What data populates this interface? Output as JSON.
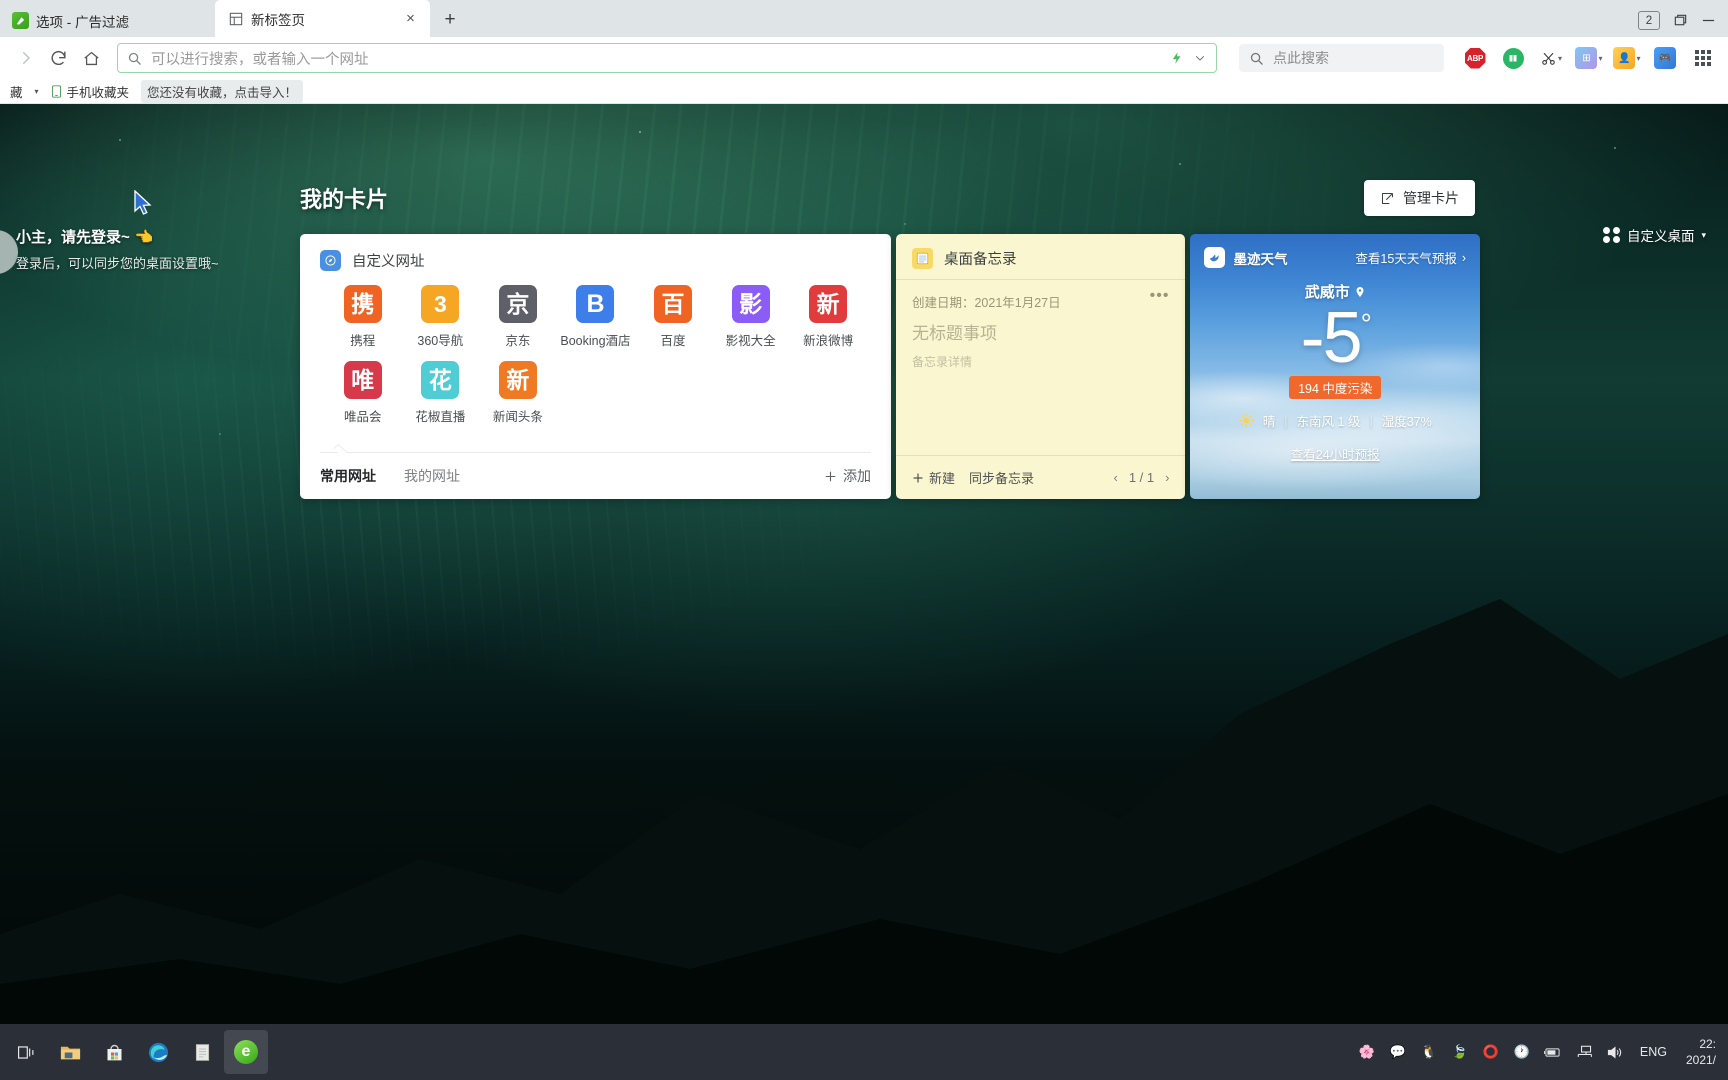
{
  "browser": {
    "tabs": [
      {
        "title": "选项 - 广告过滤",
        "favicon": "shield-green-icon",
        "active": false
      },
      {
        "title": "新标签页",
        "favicon": "grid-tab-icon",
        "active": true
      }
    ],
    "new_tab_button": "+",
    "tab_count_badge": "2",
    "window_controls": {
      "restore": "restore-icon",
      "minimize": "minimize-icon"
    },
    "nav": {
      "forward": "chevron-right-icon",
      "reload": "reload-icon",
      "home": "home-icon"
    },
    "omnibox": {
      "search_icon": "search-icon",
      "placeholder": "可以进行搜索，或者输入一个网址",
      "value": "",
      "lightning_icon": "lightning-icon",
      "chevron_icon": "chevron-down-icon"
    },
    "searchbox": {
      "search_icon": "search-icon",
      "placeholder": "点此搜索",
      "value": ""
    },
    "extensions": [
      {
        "name": "adblock-plus-icon",
        "label": "ABP"
      },
      {
        "name": "green-shield-extension-icon",
        "label": ""
      },
      {
        "name": "scissors-capture-icon",
        "label": ""
      },
      {
        "name": "puzzle-extension-icon",
        "label": ""
      },
      {
        "name": "account-extension-icon",
        "label": ""
      },
      {
        "name": "game-extension-icon",
        "label": ""
      },
      {
        "name": "apps-grid-icon",
        "label": ""
      }
    ],
    "bookmarks": {
      "overflow_label": "藏",
      "caret": "chevron-down-icon",
      "mobile_folder": "手机收藏夹",
      "import_hint": "您还没有收藏，点击导入！"
    }
  },
  "desktop": {
    "login_hint": {
      "line1": "小主，请先登录~",
      "hand_emoji": "👈",
      "line2": "登录后，可以同步您的桌面设置哦~"
    },
    "customize_button": {
      "icon": "grid-four-dots-icon",
      "label": "自定义桌面",
      "caret": "chevron-down-icon"
    }
  },
  "cards": {
    "section_title": "我的卡片",
    "manage_button": {
      "icon": "edit-square-icon",
      "label": "管理卡片"
    },
    "url_card": {
      "icon": "compass-icon",
      "icon_color": "#4a90e2",
      "title": "自定义网址",
      "sites": [
        {
          "label": "携程",
          "glyph": "携",
          "color": "#ef6422"
        },
        {
          "label": "360导航",
          "glyph": "3",
          "color": "#f5a623"
        },
        {
          "label": "京东",
          "glyph": "京",
          "color": "#5e5f68"
        },
        {
          "label": "Booking酒店",
          "glyph": "B",
          "color": "#3d7ee8"
        },
        {
          "label": "百度",
          "glyph": "百",
          "color": "#ef6422"
        },
        {
          "label": "影视大全",
          "glyph": "影",
          "color": "#8b5cf6"
        },
        {
          "label": "新浪微博",
          "glyph": "新",
          "color": "#e23b3b"
        },
        {
          "label": "唯品会",
          "glyph": "唯",
          "color": "#d6394a"
        },
        {
          "label": "花椒直播",
          "glyph": "花",
          "color": "#4ecdd4"
        },
        {
          "label": "新闻头条",
          "glyph": "新",
          "color": "#f07a23"
        }
      ],
      "tabs": [
        {
          "label": "常用网址",
          "selected": true
        },
        {
          "label": "我的网址",
          "selected": false
        }
      ],
      "add_label": "添加",
      "add_icon": "plus-icon"
    },
    "memo_card": {
      "icon": "notepad-icon",
      "title": "桌面备忘录",
      "created_label": "创建日期：2021年1月27日",
      "more_icon": "ellipsis-icon",
      "note_title": "无标题事项",
      "note_detail": "备忘录详情",
      "new_label": "新建",
      "new_icon": "plus-icon",
      "sync_label": "同步备忘录",
      "prev_icon": "chevron-left-icon",
      "next_icon": "chevron-right-icon",
      "page_indicator": "1 / 1"
    },
    "weather_card": {
      "brand_icon": "moji-bird-icon",
      "brand": "墨迹天气",
      "forecast_link": "查看15天天气预报",
      "forecast_chevron": "chevron-right-icon",
      "city": "武威市",
      "pin_icon": "location-pin-icon",
      "temperature": "-5",
      "degree": "°",
      "aqi": "194 中度污染",
      "aqi_color": "#f0682b",
      "condition_icon": "sun-icon",
      "condition": "晴",
      "wind": "东南风 1 级",
      "humidity": "湿度37%",
      "hourly_link": "查看24小时预报"
    }
  },
  "taskbar": {
    "start": {
      "icon": "task-view-icon"
    },
    "apps": [
      {
        "name": "file-explorer-icon",
        "glyph": "📁",
        "active": false
      },
      {
        "name": "microsoft-store-icon",
        "glyph": "🛍",
        "active": false
      },
      {
        "name": "edge-browser-icon",
        "glyph": "🌐",
        "active": false
      },
      {
        "name": "notepad-icon",
        "glyph": "📓",
        "active": false
      },
      {
        "name": "browser-360-icon",
        "glyph": "e",
        "active": true
      }
    ],
    "tray": [
      {
        "name": "flower-tray-icon",
        "glyph": "🌸"
      },
      {
        "name": "wechat-tray-icon",
        "glyph": "💬"
      },
      {
        "name": "qq-tray-icon",
        "glyph": "🐧"
      },
      {
        "name": "green-app-tray-icon",
        "glyph": "🍃"
      },
      {
        "name": "thunder-tray-icon",
        "glyph": "⭕"
      },
      {
        "name": "clock-tray-icon",
        "glyph": "🕐"
      },
      {
        "name": "battery-icon",
        "glyph": "🔋"
      },
      {
        "name": "network-icon",
        "glyph": "🖧"
      },
      {
        "name": "volume-icon",
        "glyph": "🔊"
      }
    ],
    "language": "ENG",
    "clock_time": "22:",
    "clock_date": "2021/"
  }
}
